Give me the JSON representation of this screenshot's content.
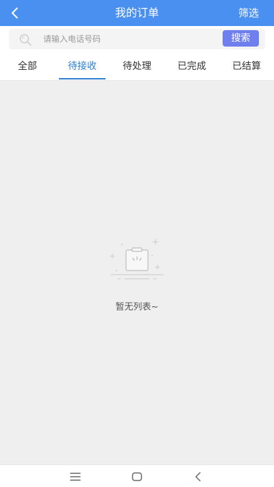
{
  "header": {
    "title": "我的订单",
    "filter_label": "筛选",
    "color": "#4a90f0"
  },
  "search": {
    "placeholder": "请输入电话号码",
    "value": "",
    "button_label": "搜索",
    "button_color": "#6f80ee"
  },
  "tabs": [
    {
      "label": "全部",
      "active": false
    },
    {
      "label": "待接收",
      "active": true
    },
    {
      "label": "待处理",
      "active": false
    },
    {
      "label": "已完成",
      "active": false
    },
    {
      "label": "已结算",
      "active": false
    }
  ],
  "active_tab_color": "#2e7fcf",
  "empty_state": {
    "icon": "empty-clipboard-icon",
    "text": "暂无列表~"
  },
  "system_nav": {
    "icons": [
      "menu-icon",
      "home-icon",
      "back-icon"
    ]
  }
}
